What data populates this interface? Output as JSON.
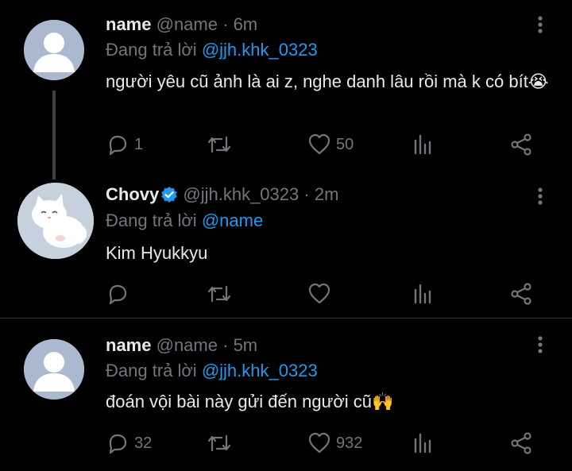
{
  "tweets": [
    {
      "name": "name",
      "handle": "@name",
      "time": "6m",
      "replying_prefix": "Đang trả lời",
      "replying_to": "@jjh.khk_0323",
      "text": "người yêu cũ ảnh là ai z, nghe danh lâu rồi mà k có bít😭",
      "replies": "1",
      "retweets": "",
      "likes": "50",
      "avatar": "default-avatar-icon"
    },
    {
      "name": "Chovy",
      "verified": true,
      "handle": "@jjh.khk_0323",
      "time": "2m",
      "replying_prefix": "Đang trả lời",
      "replying_to": "@name",
      "text": "Kim Hyukkyu",
      "replies": "",
      "retweets": "",
      "likes": "",
      "avatar": "cat-avatar-icon"
    },
    {
      "name": "name",
      "handle": "@name",
      "time": "5m",
      "replying_prefix": "Đang trả lời",
      "replying_to": "@jjh.khk_0323",
      "text": "đoán vội bài này gửi đến người cũ🙌",
      "replies": "32",
      "retweets": "",
      "likes": "932",
      "avatar": "default-avatar-icon"
    }
  ],
  "separator": "·",
  "colors": {
    "background": "#000000",
    "text": "#e7e9ea",
    "muted": "#71767b",
    "link": "#1d9bf0",
    "verified_badge": "#1d9bf0",
    "avatar_bg": "#b8c4d6"
  }
}
